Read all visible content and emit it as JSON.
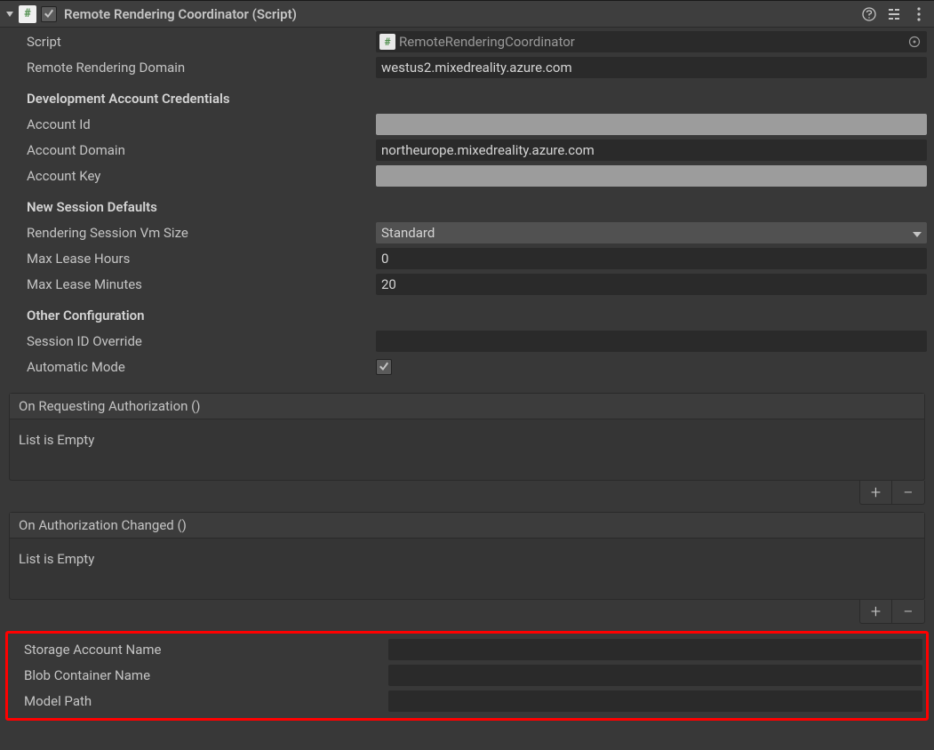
{
  "header": {
    "title": "Remote Rendering Coordinator (Script)"
  },
  "fields": {
    "script": {
      "label": "Script",
      "value": "RemoteRenderingCoordinator"
    },
    "remote_domain": {
      "label": "Remote Rendering Domain",
      "value": "westus2.mixedreality.azure.com"
    }
  },
  "sections": {
    "dev": {
      "title": "Development Account Credentials",
      "account_id": {
        "label": "Account Id",
        "value": ""
      },
      "account_domain": {
        "label": "Account Domain",
        "value": "northeurope.mixedreality.azure.com"
      },
      "account_key": {
        "label": "Account Key",
        "value": ""
      }
    },
    "session": {
      "title": "New Session Defaults",
      "vm_size": {
        "label": "Rendering Session Vm Size",
        "value": "Standard"
      },
      "max_hours": {
        "label": "Max Lease Hours",
        "value": "0"
      },
      "max_minutes": {
        "label": "Max Lease Minutes",
        "value": "20"
      }
    },
    "other": {
      "title": "Other Configuration",
      "session_override": {
        "label": "Session ID Override",
        "value": ""
      },
      "automatic_mode": {
        "label": "Automatic Mode",
        "checked": true
      }
    }
  },
  "events": {
    "request_auth": {
      "title": "On Requesting Authorization ()",
      "empty_text": "List is Empty"
    },
    "auth_changed": {
      "title": "On Authorization Changed ()",
      "empty_text": "List is Empty"
    }
  },
  "storage": {
    "storage_name": {
      "label": "Storage Account Name",
      "value": ""
    },
    "blob_container": {
      "label": "Blob Container Name",
      "value": ""
    },
    "model_path": {
      "label": "Model Path",
      "value": ""
    }
  },
  "icons": {
    "hash": "#",
    "plus": "+",
    "minus": "−"
  }
}
